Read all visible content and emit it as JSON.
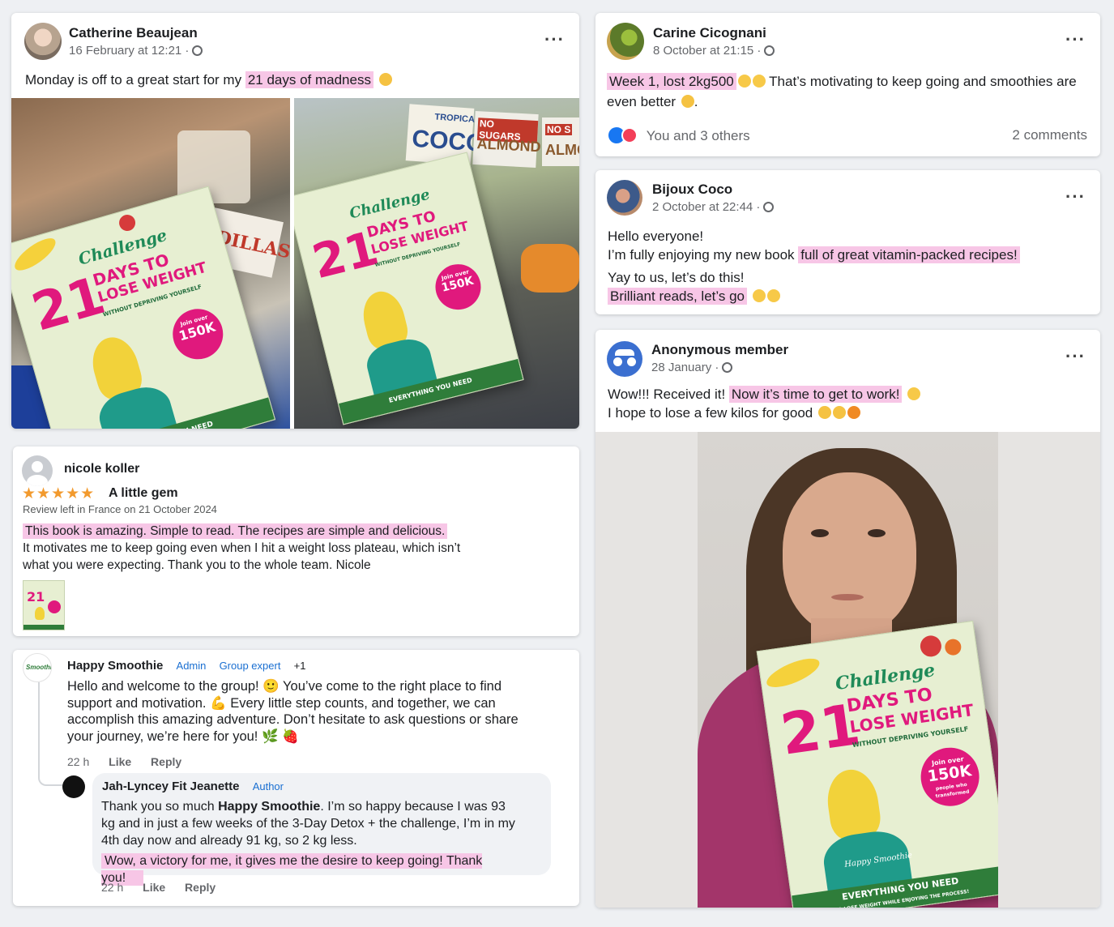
{
  "post1": {
    "author": "Catherine Beaujean",
    "time": "16 February at 12:21 ·",
    "text_plain": "Monday is off to a great start for my ",
    "text_highlight": "21 days of madness",
    "more": "···"
  },
  "post2": {
    "author": "Carine Cicognani",
    "time": "8 October at 21:15 ·",
    "text_highlight": "Week 1, lost 2kg500",
    "text_plain": "  That’s motivating to keep going and smoothies are even better",
    "reactions": "You and 3 others",
    "comments": "2 comments",
    "more": "···"
  },
  "post3": {
    "author": "Bijoux Coco",
    "time": "2 October at 22:44 ·",
    "line1": "Hello everyone!",
    "line2_plain": "I’m fully enjoying my new book ",
    "line2_highlight": "full of great vitamin-packed recipes!",
    "line3": "Yay to us, let’s do this!",
    "line4_highlight": "Brilliant reads, let’s go",
    "more": "···"
  },
  "post4": {
    "author": "Anonymous member",
    "time": "28 January ·",
    "line1_plain": "Wow!!! Received it! ",
    "line1_highlight": "Now it’s time to get to work!",
    "line2": "I hope to lose a few kilos for good",
    "more": "···"
  },
  "review": {
    "author": "nicole koller",
    "stars": "★★★★★",
    "title": "A little gem",
    "meta": "Review left in France on 21 October 2024",
    "line1_highlight": "This book is amazing. Simple to read. The recipes are simple and delicious.",
    "line2": "It motivates me to keep going even when I hit a weight loss plateau, which isn’t",
    "line3": "what you were expecting. Thank you to the whole team. Nicole"
  },
  "comment": {
    "author": "Happy Smoothie",
    "badge1": "Admin",
    "badge2": "Group expert",
    "badge3": "+1",
    "logo": "Smoothie",
    "text": "Hello and welcome to the group! 🙂  You’ve come to the right place to find support and motivation. 💪 Every little step counts, and together, we can accomplish this amazing adventure. Don’t hesitate to ask questions or share your journey, we’re here for you! 🌿 🍓",
    "age": "22 h",
    "like": "Like",
    "reply": "Reply"
  },
  "reply": {
    "author": "Jah-Lyncey Fit Jeanette",
    "badge": "Author",
    "text_a": "Thank you so much ",
    "text_bold": "Happy Smoothie",
    "text_b": ". I’m so happy because I was 93 kg and in just a few weeks of the 3-Day Detox + the challenge, I’m in my 4th day now and already 91 kg, so 2 kg less.",
    "highlight": "Wow, a victory for me, it gives me the desire to keep going! Thank you!",
    "age": "22 h",
    "like": "Like",
    "reply": "Reply"
  },
  "book": {
    "challenge": "Challenge",
    "number": "21",
    "days": "DAYS TO",
    "lose": "LOSE WEIGHT",
    "subtitle": "WITHOUT DEPRIVING YOURSELF",
    "join": "Join over",
    "count": "150K",
    "people": "people who transformed",
    "brand": "Happy Smoothie",
    "band1": "EVERYTHING YOU NEED",
    "band2": "TO LOSE WEIGHT WHILE ENJOYING THE PROCESS!"
  },
  "packaging": {
    "tropical": "TROPICAL",
    "coco": "COCO",
    "nosugars": "NO SUGARS",
    "almond": "ALMOND",
    "nosugars2": "NO S",
    "almond2": "ALMO",
    "cadillas": "CADILLAS"
  },
  "colors": {
    "highlight": "#f7c6e6",
    "accent_pink": "#e0197d",
    "link_blue": "#1a6fd1"
  }
}
